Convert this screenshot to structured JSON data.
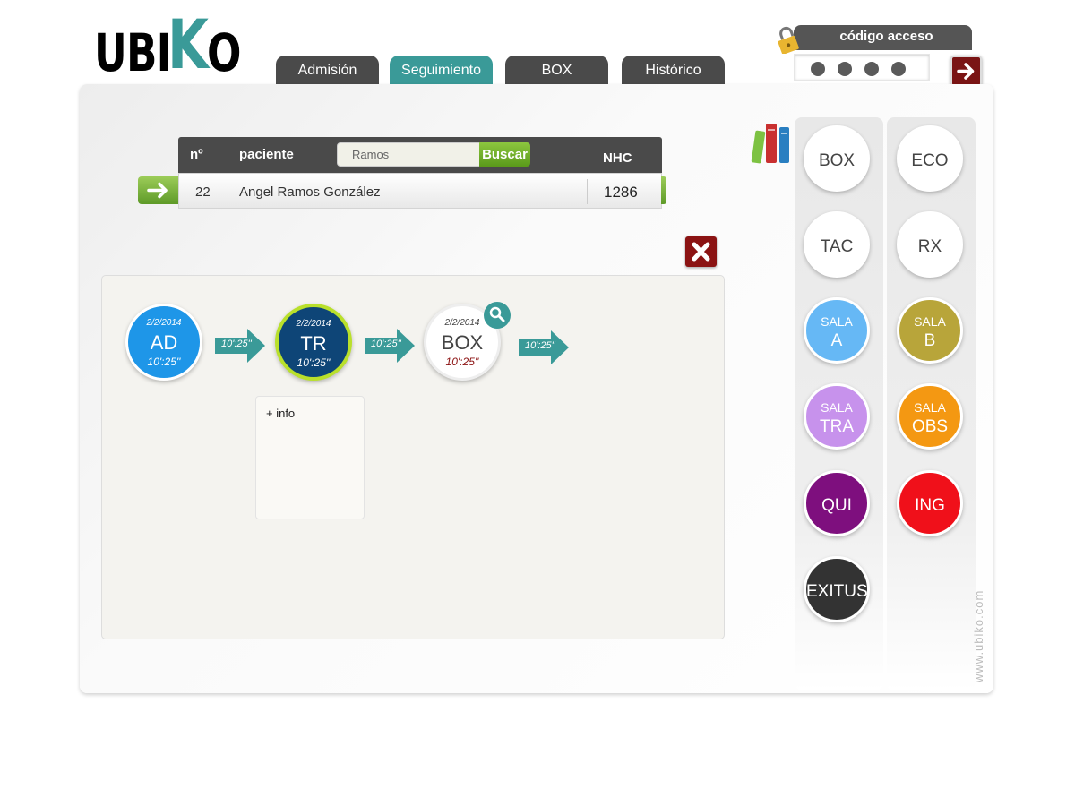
{
  "logo": {
    "part1": "UBI",
    "part2": "K",
    "part3": "O"
  },
  "tabs": [
    {
      "label": "Admisión",
      "active": false
    },
    {
      "label": "Seguimiento",
      "active": true
    },
    {
      "label": "BOX",
      "active": false
    },
    {
      "label": "Histórico",
      "active": false
    }
  ],
  "access": {
    "title": "código acceso",
    "icon": "padlock-icon",
    "go_icon": "arrow-right-icon"
  },
  "search": {
    "col_n": "nº",
    "col_patient": "paciente",
    "col_nhc": "NHC",
    "input_value": "Ramos",
    "button": "Buscar",
    "result": {
      "n": "22",
      "name": "Angel Ramos González",
      "nhc": "1286"
    }
  },
  "close_icon": "close-x-icon",
  "flow": {
    "steps": [
      {
        "date": "2/2/2014",
        "code": "AD",
        "time": "10':25''",
        "color": "#1e96e8"
      },
      {
        "date": "2/2/2014",
        "code": "TR",
        "time": "10':25''",
        "color": "#0e4577",
        "ring": "#b9e02b"
      },
      {
        "date": "2/2/2014",
        "code": "BOX",
        "time": "10':25''",
        "color": "#ffffff",
        "time_color": "#8b1010"
      }
    ],
    "arrows": [
      "10':25''",
      "10':25''",
      "10':25''"
    ],
    "info_label": "+ info"
  },
  "locations": {
    "col1": [
      {
        "l1": "BOX",
        "color": "#ffffff",
        "text": "#444444"
      },
      {
        "l1": "TAC",
        "color": "#ffffff",
        "text": "#444444"
      },
      {
        "l1": "SALA",
        "l2": "A",
        "color": "#66b8f5",
        "text": "#ffffff"
      },
      {
        "l1": "SALA",
        "l2": "TRA",
        "color": "#c792ec",
        "text": "#ffffff"
      },
      {
        "l1": "QUI",
        "color": "#7e0f7e",
        "text": "#ffffff"
      },
      {
        "l1": "EXITUS",
        "color": "#333333",
        "text": "#ffffff"
      }
    ],
    "col2": [
      {
        "l1": "ECO",
        "color": "#ffffff",
        "text": "#444444"
      },
      {
        "l1": "RX",
        "color": "#ffffff",
        "text": "#444444"
      },
      {
        "l1": "SALA",
        "l2": "B",
        "color": "#b8a53a",
        "text": "#ffffff"
      },
      {
        "l1": "SALA",
        "l2": "OBS",
        "color": "#f49812",
        "text": "#ffffff"
      },
      {
        "l1": "ING",
        "color": "#f0101a",
        "text": "#ffffff"
      }
    ]
  },
  "watermark": "www.ubiko.com"
}
